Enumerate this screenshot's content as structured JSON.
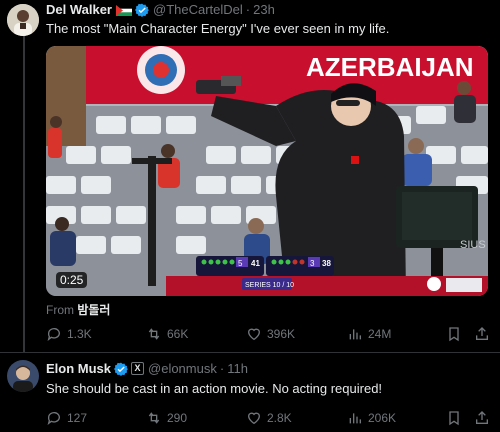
{
  "tweet1": {
    "name": "Del Walker",
    "handle": "@TheCartelDel",
    "time": "23h",
    "text": "The most \"Main Character Energy\" I've ever seen in my life.",
    "video": {
      "duration": "0:25",
      "banner_text": "AZERBAIJAN",
      "scoreboard": {
        "left_score": "41",
        "right_score": "38",
        "left_sets": "5",
        "right_sets": "3",
        "series": "SERIES 10 / 10"
      },
      "monitor_text": "SIUS"
    },
    "from_label": "From",
    "from_name": "밤돌러",
    "stats": {
      "replies": "1.3K",
      "reposts": "66K",
      "likes": "396K",
      "views": "24M"
    }
  },
  "tweet2": {
    "name": "Elon Musk",
    "handle": "@elonmusk",
    "time": "11h",
    "text": "She should be cast in an action movie. No  acting required!",
    "stats": {
      "replies": "127",
      "reposts": "290",
      "likes": "2.8K",
      "views": "206K"
    }
  },
  "colors": {
    "verified": "#1d9bf0",
    "muted": "#71767b",
    "text": "#e7e9ea"
  }
}
